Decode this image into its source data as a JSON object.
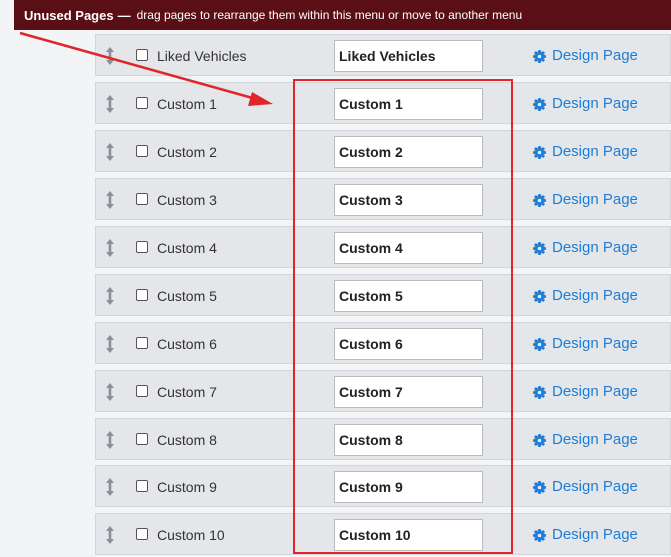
{
  "section": {
    "title": "Unused Pages",
    "separator": "—",
    "description": "drag pages to rearrange them within this menu or move to another menu"
  },
  "colors": {
    "banner_bg": "#5a0e15",
    "link": "#1c7ed6",
    "highlight": "#e0252b",
    "row_bg": "#e4e6ea"
  },
  "icons": {
    "drag": "drag-handle-icon",
    "gear": "gear-icon"
  },
  "rows": [
    {
      "label": "Liked Vehicles",
      "value": "Liked Vehicles",
      "action": "Design Page"
    },
    {
      "label": "Custom 1",
      "value": "Custom 1",
      "action": "Design Page"
    },
    {
      "label": "Custom 2",
      "value": "Custom 2",
      "action": "Design Page"
    },
    {
      "label": "Custom 3",
      "value": "Custom 3",
      "action": "Design Page"
    },
    {
      "label": "Custom 4",
      "value": "Custom 4",
      "action": "Design Page"
    },
    {
      "label": "Custom 5",
      "value": "Custom 5",
      "action": "Design Page"
    },
    {
      "label": "Custom 6",
      "value": "Custom 6",
      "action": "Design Page"
    },
    {
      "label": "Custom 7",
      "value": "Custom 7",
      "action": "Design Page"
    },
    {
      "label": "Custom 8",
      "value": "Custom 8",
      "action": "Design Page"
    },
    {
      "label": "Custom 9",
      "value": "Custom 9",
      "action": "Design Page"
    },
    {
      "label": "Custom 10",
      "value": "Custom 10",
      "action": "Design Page"
    }
  ]
}
